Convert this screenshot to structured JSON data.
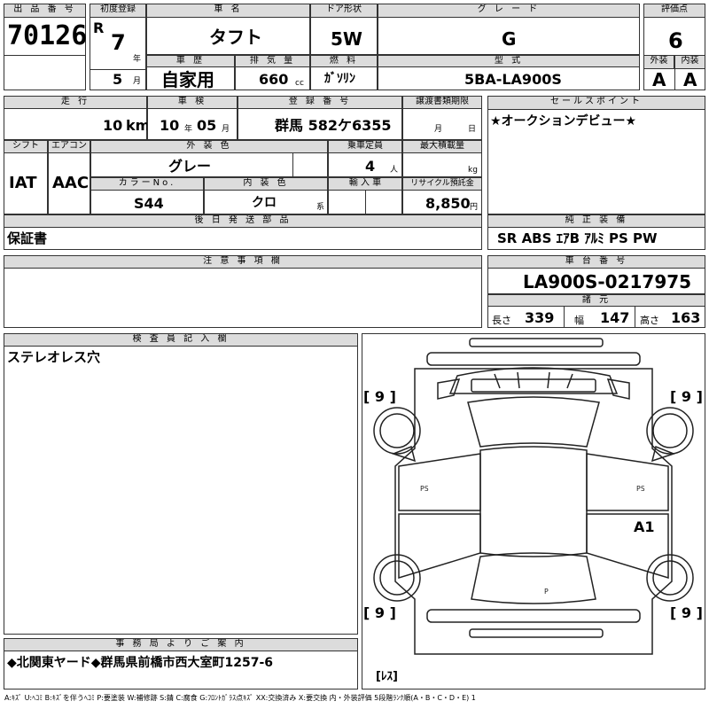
{
  "header": {
    "lot_label": "出 品 番 号",
    "lot_no": "70126",
    "first_reg_label": "初度登録",
    "era": "R",
    "year_value": "7",
    "year_unit": "年",
    "month_value": "5",
    "month_unit": "月",
    "name_label": "車  名",
    "name": "タフト",
    "door_label": "ドア形状",
    "door": "5W",
    "grade_label": "グ レ ー ド",
    "grade": "G",
    "score_label": "評価点",
    "score": "6",
    "history_label": "車 歴",
    "history": "自家用",
    "displacement_label": "排 気 量",
    "displacement": "660",
    "displacement_unit": "cc",
    "fuel_label": "燃 料",
    "fuel": "ｶﾞｿﾘﾝ",
    "model_label": "型 式",
    "model": "5BA-LA900S",
    "exterior_label": "外装",
    "exterior": "A",
    "interior_label": "内装",
    "interior": "A"
  },
  "row2": {
    "mileage_label": "走 行",
    "mileage": "10",
    "mileage_unit": "km",
    "inspection_label": "車 検",
    "insp_year": "10",
    "insp_year_unit": "年",
    "insp_month": "05",
    "insp_month_unit": "月",
    "plate_label": "登 録 番 号",
    "plate": "群馬 582ケ6355",
    "transfer_label": "譲渡書類期限",
    "transfer_month_unit": "月",
    "transfer_day_unit": "日",
    "sales_label": "セールスポイント",
    "sales_text": "★オークションデビュー★"
  },
  "row3": {
    "shift_label": "シフト",
    "shift": "IAT",
    "ac_label": "エアコン",
    "ac": "AAC",
    "color_label": "外 装 色",
    "color": "グレー",
    "capacity_label": "乗車定員",
    "capacity": "4",
    "capacity_unit": "人",
    "load_label": "最大積載量",
    "load_unit": "kg",
    "color_no_label": "カラーNo.",
    "color_no": "S44",
    "int_color_label": "内 装 色",
    "int_color": "クロ",
    "int_color_unit": "系",
    "import_label": "輸 入 車",
    "recycle_label": "リサイクル預託金",
    "recycle": "8,850",
    "recycle_unit": "円"
  },
  "later": {
    "label": "後 日 発 送 部 品",
    "text": "保証書"
  },
  "equipment": {
    "label": "純 正 装 備",
    "text": "SR  ABS  ｴｱB  ｱﾙﾐ  PS  PW"
  },
  "notes": {
    "label": "注 意 事 項 欄"
  },
  "chassis": {
    "label": "車 台 番 号",
    "value": "LA900S-0217975"
  },
  "specs": {
    "label": "諸 元",
    "length_label": "長さ",
    "length": "339",
    "width_label": "幅",
    "width": "147",
    "height_label": "高さ",
    "height": "163"
  },
  "inspector": {
    "label": "検 査 員 記 入 欄",
    "text": "ステレオレス穴"
  },
  "diagram": {
    "tire_fl": "[ 9 ]",
    "tire_fr": "[ 9 ]",
    "tire_rl": "[ 9 ]",
    "tire_rr": "[ 9 ]",
    "mark_a1": "A1",
    "stereo": "[ﾚｽ]"
  },
  "office": {
    "label": "事 務 局 よ り ご 案 内",
    "text": "◆北関東ヤード◆群馬県前橋市西大室町1257-6"
  },
  "legend_text": "A:ｷｽﾞ U:ﾍｺﾐ B:ｷｽﾞを伴うﾍｺﾐ P:要塗装 W:補修跡 S:錆 C:腐食 G:ﾌﾛﾝﾄｶﾞﾗｽ点ｷｽﾞ XX:交換済み X:要交換  内・外装評価  5段階ﾗﾝｸ順(A・B・C・D・E) 1"
}
